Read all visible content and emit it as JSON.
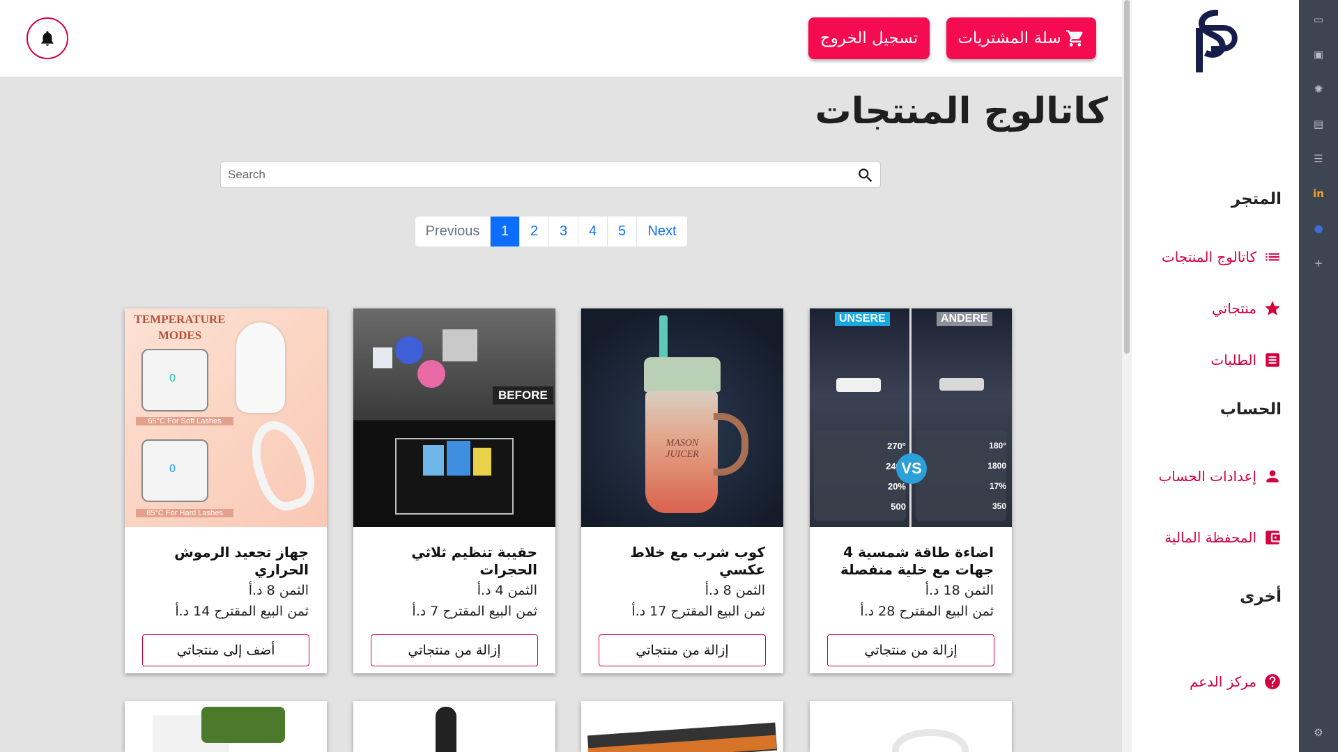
{
  "header": {
    "cart_label": "سلة المشتريات",
    "logout_label": "تسجيل الخروج"
  },
  "sidebar": {
    "logo_text": "SP",
    "sections": {
      "store": "المتجر",
      "account": "الحساب",
      "other": "أخرى"
    },
    "items": {
      "catalog": "كاتالوج المنتجات",
      "my_products": "منتجاتي",
      "orders": "الطلبات",
      "account_settings": "إعدادات الحساب",
      "wallet": "المحفظة المالية",
      "support": "مركز الدعم"
    }
  },
  "main": {
    "title": "كاتالوج المنتجات",
    "search": {
      "placeholder": "Search"
    },
    "pagination": {
      "previous": "Previous",
      "pages": [
        "1",
        "2",
        "3",
        "4",
        "5"
      ],
      "active": "1",
      "next": "Next"
    }
  },
  "products": [
    {
      "name": "اضاءة طاقة شمسية 4 جهات مع خلية منفصلة",
      "price": "الثمن 18 د.أ",
      "suggested": "ثمن البيع المقترح 28 د.أ",
      "action": "إزالة من منتجاتي",
      "img_labels": {
        "left": "UNSERE",
        "right": "ANDERE",
        "left_stats": [
          "270°",
          "2400",
          "20%",
          "500"
        ],
        "right_stats": [
          "180°",
          "1800",
          "17%",
          "350"
        ]
      }
    },
    {
      "name": "كوب شرب مع خلاط عكسي",
      "price": "الثمن 8 د.أ",
      "suggested": "ثمن البيع المقترح 17 د.أ",
      "action": "إزالة من منتجاتي",
      "img_labels": {
        "cup": "MASON JUICER"
      }
    },
    {
      "name": "حقيبة تنظيم ثلاثي الحجرات",
      "price": "الثمن 4 د.أ",
      "suggested": "ثمن البيع المقترح 7 د.أ",
      "action": "إزالة من منتجاتي",
      "img_labels": {
        "badge": "BEFORE"
      }
    },
    {
      "name": "جهاز تجعيد الرموش الحراري",
      "price": "الثمن 8 د.أ",
      "suggested": "ثمن البيع المقترح 14 د.أ",
      "action": "أضف إلى منتجاتي",
      "img_labels": {
        "title": "TEMPERATURE MODES",
        "soft": "65°C For Soft Lashes",
        "hard": "85°C For Hard Lashes",
        "mode": "0"
      }
    }
  ],
  "colors": {
    "accent": "#d3003f",
    "header_button": "#f50b50",
    "pagination_active": "#0d6efd",
    "browser_bar": "#3d4452"
  }
}
